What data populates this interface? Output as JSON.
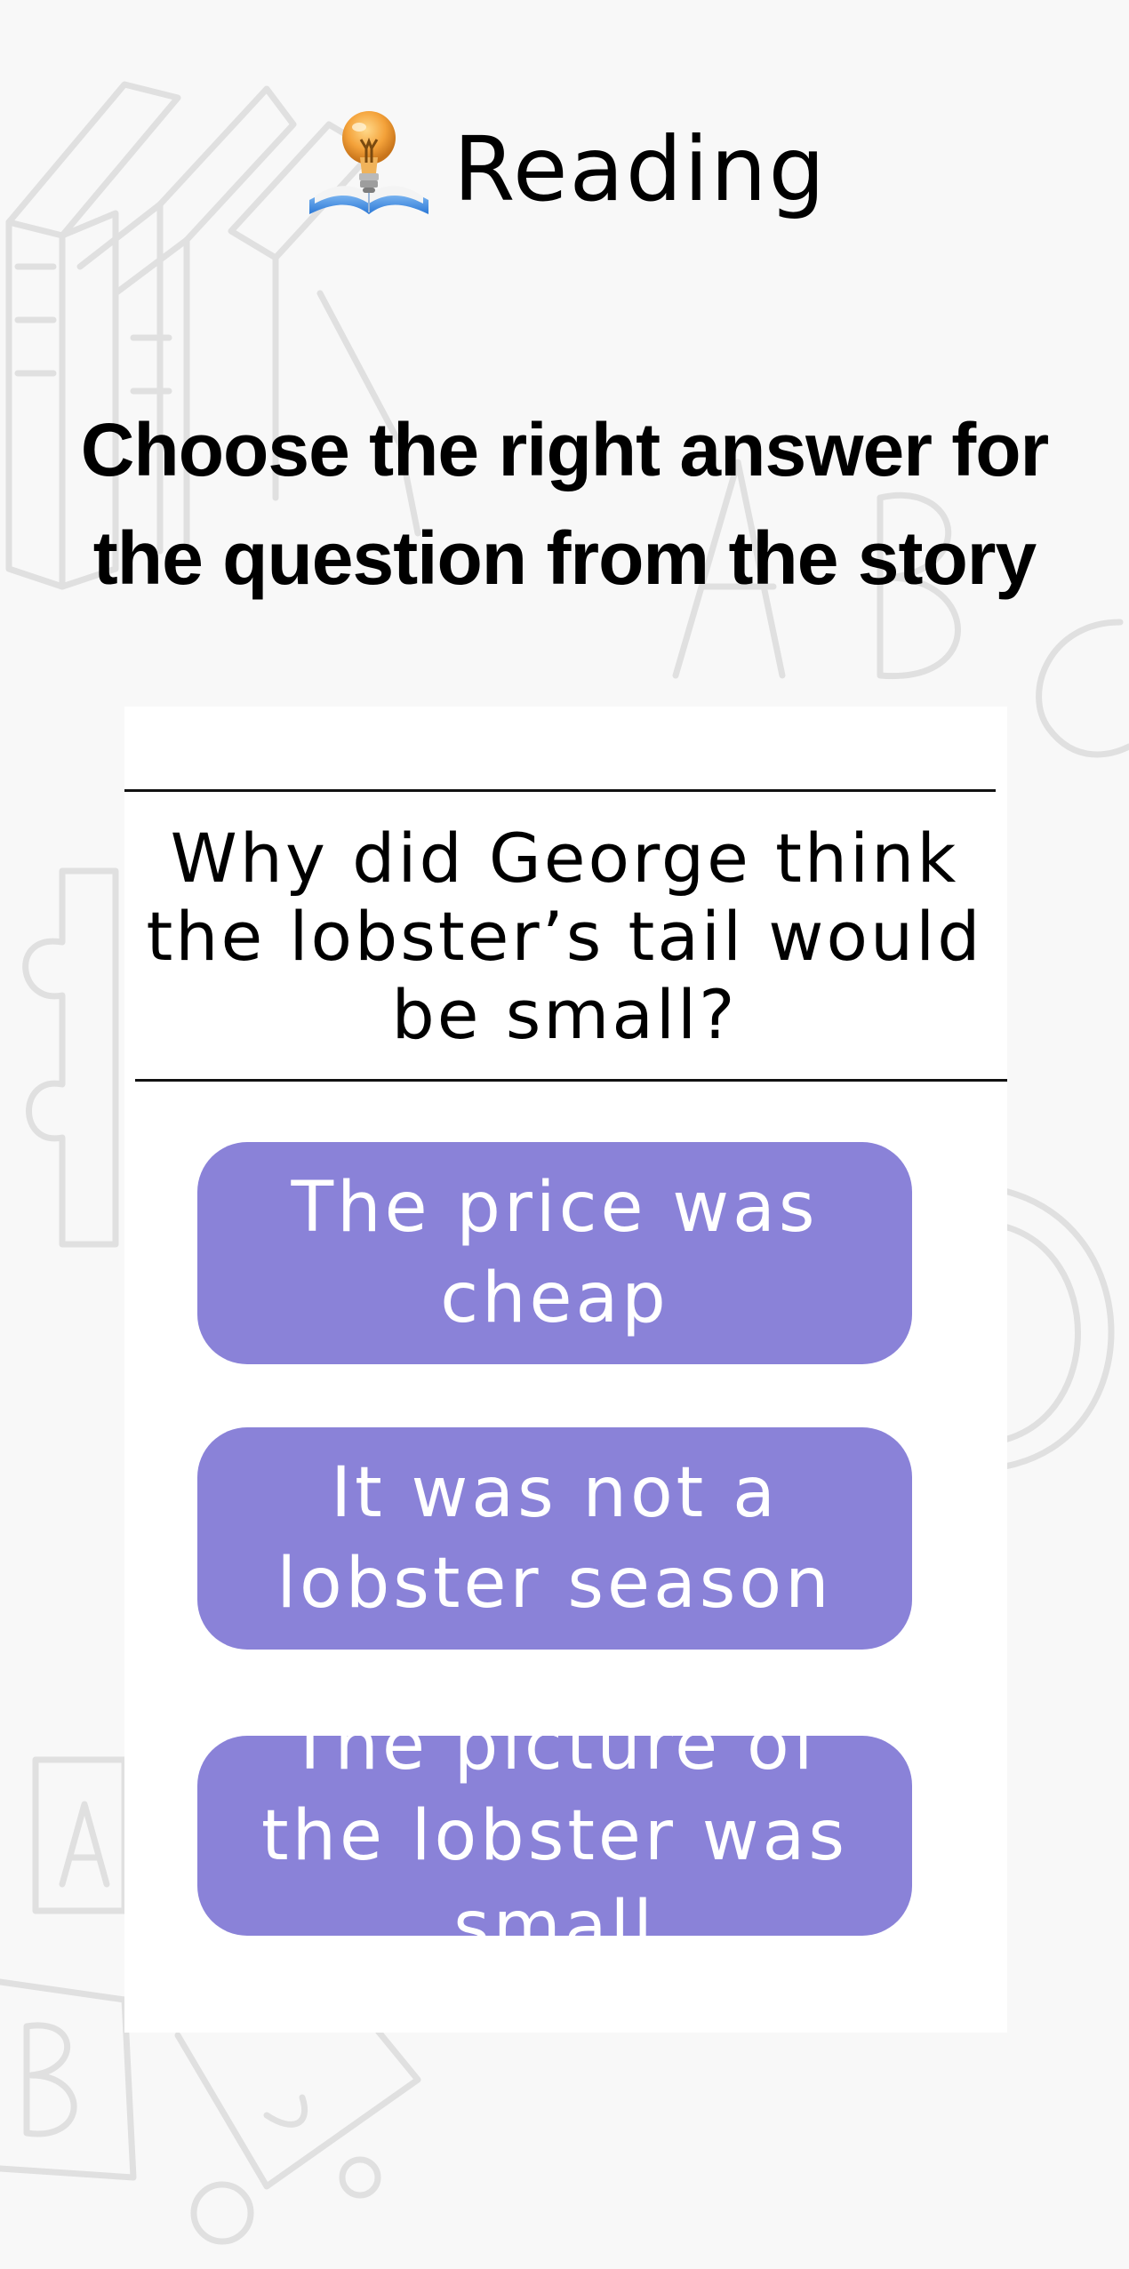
{
  "header": {
    "title": "Reading",
    "icon": "lightbulb-book-icon"
  },
  "instruction": "Choose the right answer for the question from the story",
  "question": "Why did George think the lobster’s tail would be small?",
  "answers": [
    {
      "label": "The price was cheap"
    },
    {
      "label": "It was not a lobster season"
    },
    {
      "label": "The picture of the lobster was small"
    }
  ],
  "colors": {
    "background": "#f8f8f8",
    "card": "#ffffff",
    "answer_button": "#8a82d8",
    "answer_text": "#ffffff",
    "doodle": "#e2e2e2"
  }
}
